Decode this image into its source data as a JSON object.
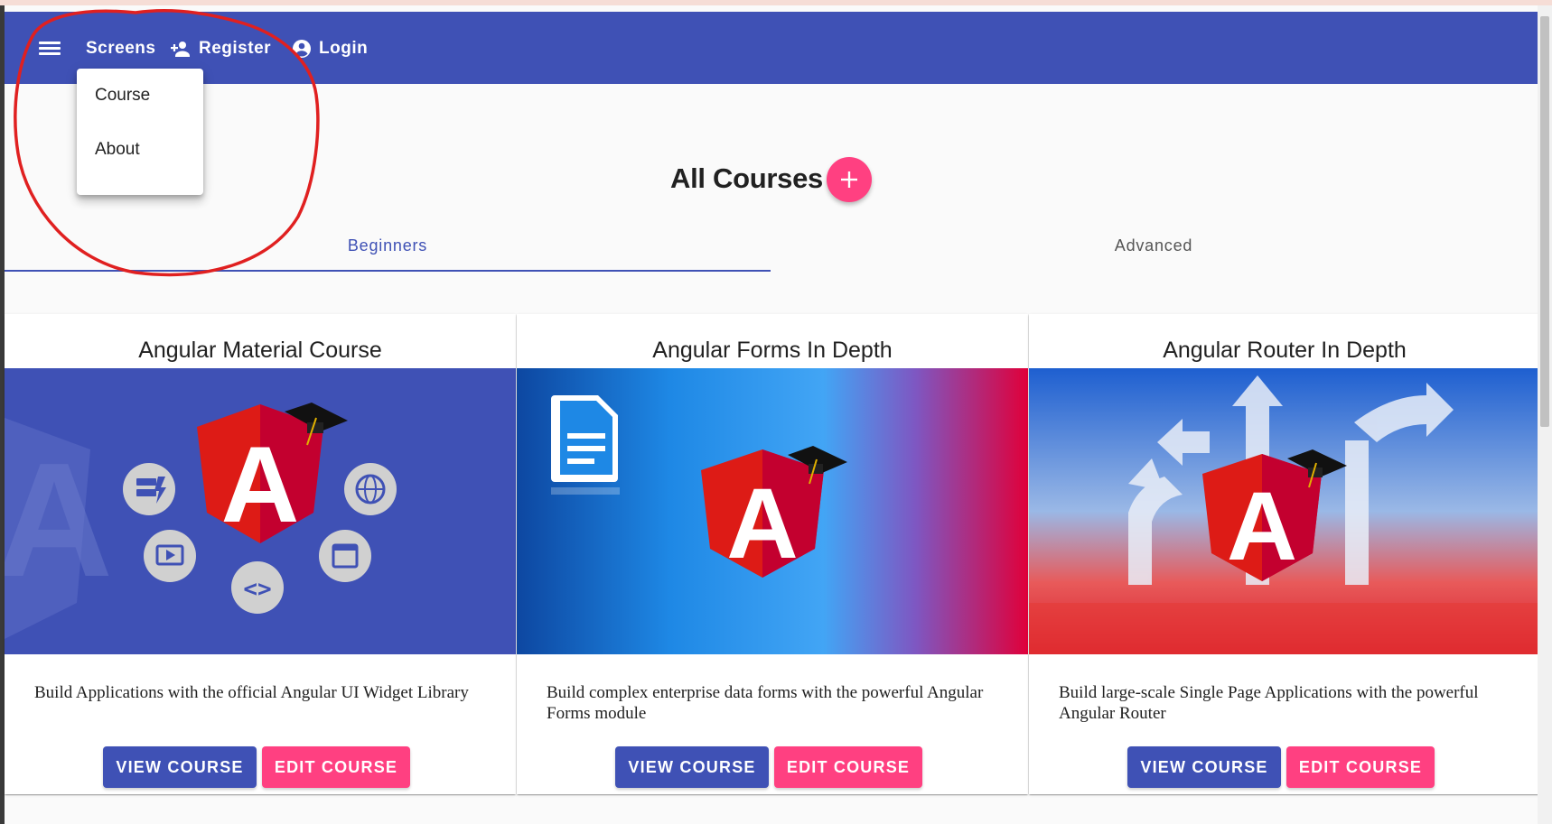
{
  "toolbar": {
    "menu_icon": "menu-icon",
    "screens_label": "Screens",
    "register_label": "Register",
    "register_icon": "person-add-icon",
    "login_label": "Login",
    "login_icon": "account-circle-icon",
    "background_color": "#3f51b5"
  },
  "screens_menu": {
    "items": [
      {
        "label": "Course"
      },
      {
        "label": "About"
      }
    ]
  },
  "main": {
    "title": "All Courses",
    "add_icon": "plus-icon",
    "fab_color": "#ff4081",
    "tabs": [
      {
        "label": "Beginners",
        "active": true
      },
      {
        "label": "Advanced",
        "active": false
      }
    ]
  },
  "courses": [
    {
      "title": "Angular Material Course",
      "description": "Build Applications with the official Angular UI Widget Library",
      "view_label": "VIEW COURSE",
      "edit_label": "EDIT COURSE"
    },
    {
      "title": "Angular Forms In Depth",
      "description": "Build complex enterprise data forms with the powerful Angular Forms module",
      "view_label": "VIEW COURSE",
      "edit_label": "EDIT COURSE"
    },
    {
      "title": "Angular Router In Depth",
      "description": "Build large-scale Single Page Applications with the powerful Angular Router",
      "view_label": "VIEW COURSE",
      "edit_label": "EDIT COURSE"
    }
  ],
  "colors": {
    "primary": "#3f51b5",
    "accent": "#ff4081",
    "annotation": "#e02020"
  }
}
